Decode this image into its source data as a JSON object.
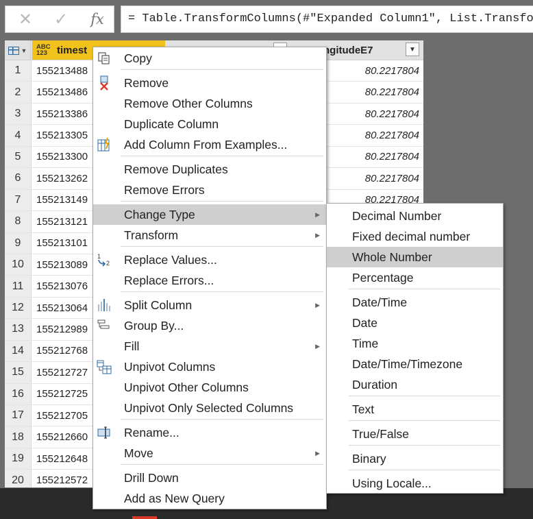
{
  "formula_bar": {
    "cancel_glyph": "✕",
    "confirm_glyph": "✓",
    "fx_label": "fx",
    "formula": "= Table.TransformColumns(#\"Expanded Column1\", List.Transform"
  },
  "grid": {
    "type_badge_top": "ABC",
    "type_badge_bottom": "123",
    "columns": [
      {
        "label": "timest",
        "selected": true
      },
      {
        "label": ""
      },
      {
        "label": "ngitudeE7"
      }
    ],
    "rows": [
      {
        "num": "1",
        "timestamp": "155213488",
        "longitude": "80.2217804"
      },
      {
        "num": "2",
        "timestamp": "155213486",
        "longitude": "80.2217804"
      },
      {
        "num": "3",
        "timestamp": "155213386",
        "longitude": "80.2217804"
      },
      {
        "num": "4",
        "timestamp": "155213305",
        "longitude": "80.2217804"
      },
      {
        "num": "5",
        "timestamp": "155213300",
        "longitude": "80.2217804"
      },
      {
        "num": "6",
        "timestamp": "155213262",
        "longitude": "80.2217804"
      },
      {
        "num": "7",
        "timestamp": "155213149",
        "longitude": "80.2217804"
      },
      {
        "num": "8",
        "timestamp": "155213121",
        "longitude": ""
      },
      {
        "num": "9",
        "timestamp": "155213101",
        "longitude": ""
      },
      {
        "num": "10",
        "timestamp": "155213089",
        "longitude": ""
      },
      {
        "num": "11",
        "timestamp": "155213076",
        "longitude": ""
      },
      {
        "num": "12",
        "timestamp": "155213064",
        "longitude": ""
      },
      {
        "num": "13",
        "timestamp": "155212989",
        "longitude": ""
      },
      {
        "num": "14",
        "timestamp": "155212768",
        "longitude": ""
      },
      {
        "num": "15",
        "timestamp": "155212727",
        "longitude": ""
      },
      {
        "num": "16",
        "timestamp": "155212725",
        "longitude": ""
      },
      {
        "num": "17",
        "timestamp": "155212705",
        "longitude": ""
      },
      {
        "num": "18",
        "timestamp": "155212660",
        "longitude": ""
      },
      {
        "num": "19",
        "timestamp": "155212648",
        "longitude": ""
      },
      {
        "num": "20",
        "timestamp": "155212572",
        "longitude": ""
      }
    ]
  },
  "context_menu": {
    "items": [
      {
        "label": "Copy",
        "icon": "copy-icon"
      },
      {
        "label": "Remove",
        "icon": "remove-column-icon"
      },
      {
        "label": "Remove Other Columns"
      },
      {
        "label": "Duplicate Column"
      },
      {
        "label": "Add Column From Examples...",
        "icon": "add-column-from-examples-icon"
      },
      {
        "label": "Remove Duplicates"
      },
      {
        "label": "Remove Errors"
      },
      {
        "label": "Change Type",
        "submenu": true,
        "highlighted": true
      },
      {
        "label": "Transform",
        "submenu": true
      },
      {
        "label": "Replace Values...",
        "icon": "replace-values-icon",
        "icon_text_top": "1",
        "icon_text_bottom": "2"
      },
      {
        "label": "Replace Errors..."
      },
      {
        "label": "Split Column",
        "submenu": true,
        "icon": "split-column-icon"
      },
      {
        "label": "Group By...",
        "icon": "group-by-icon"
      },
      {
        "label": "Fill",
        "submenu": true
      },
      {
        "label": "Unpivot Columns",
        "icon": "unpivot-columns-icon"
      },
      {
        "label": "Unpivot Other Columns"
      },
      {
        "label": "Unpivot Only Selected Columns"
      },
      {
        "label": "Rename...",
        "icon": "rename-icon"
      },
      {
        "label": "Move",
        "submenu": true
      },
      {
        "label": "Drill Down"
      },
      {
        "label": "Add as New Query"
      }
    ]
  },
  "type_submenu": {
    "items": [
      {
        "label": "Decimal Number"
      },
      {
        "label": "Fixed decimal number"
      },
      {
        "label": "Whole Number",
        "highlighted": true
      },
      {
        "label": "Percentage"
      },
      {
        "label": "Date/Time"
      },
      {
        "label": "Date"
      },
      {
        "label": "Time"
      },
      {
        "label": "Date/Time/Timezone"
      },
      {
        "label": "Duration"
      },
      {
        "label": "Text"
      },
      {
        "label": "True/False"
      },
      {
        "label": "Binary"
      },
      {
        "label": "Using Locale..."
      }
    ]
  },
  "colors": {
    "selected_column_header": "#f1c21b",
    "menu_highlight": "#cfcfcf",
    "icon_blue": "#2b6aa3",
    "icon_red": "#d9372a",
    "icon_gold": "#e0a500"
  }
}
